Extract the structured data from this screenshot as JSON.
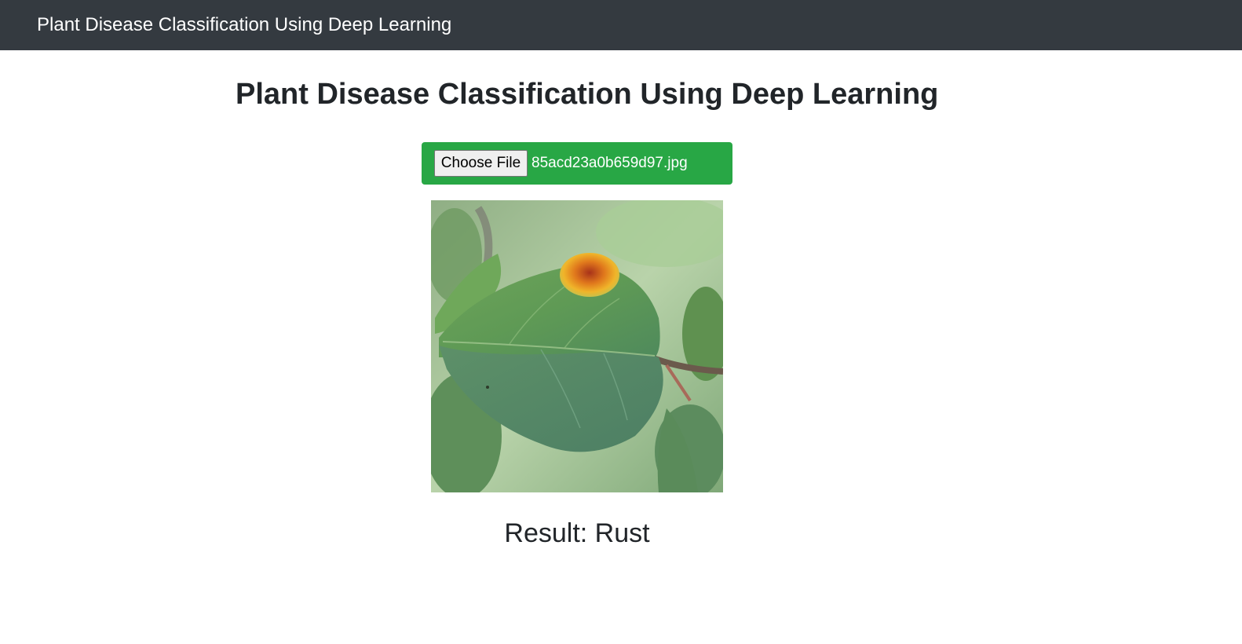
{
  "navbar": {
    "brand": "Plant Disease Classification Using Deep Learning"
  },
  "main": {
    "title": "Plant Disease Classification Using Deep Learning",
    "upload": {
      "button_label": "Choose File",
      "file_name": "85acd23a0b659d97.jpg"
    },
    "image": {
      "subject": "leaf-photo"
    },
    "result": "Result: Rust"
  },
  "colors": {
    "navbar_bg": "#343a40",
    "upload_bg": "#28a745",
    "text": "#212529"
  }
}
